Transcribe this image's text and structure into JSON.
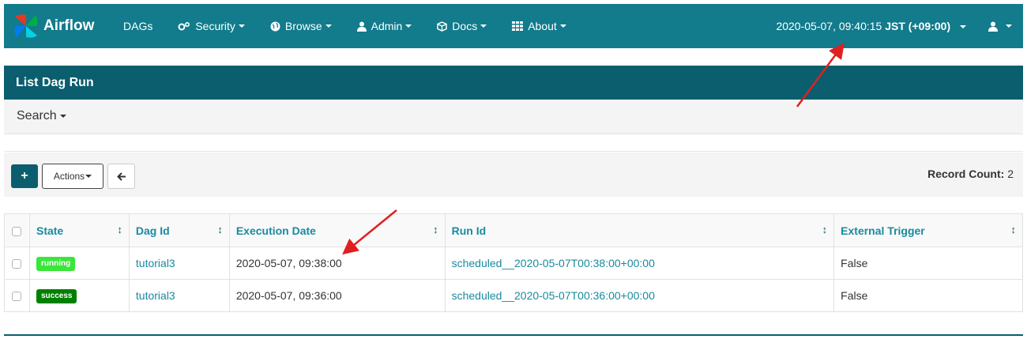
{
  "navbar": {
    "brand": "Airflow",
    "items": [
      {
        "label": "DAGs",
        "icon": "none",
        "dropdown": false
      },
      {
        "label": "Security",
        "icon": "cogs-icon",
        "dropdown": true
      },
      {
        "label": "Browse",
        "icon": "globe-icon",
        "dropdown": true
      },
      {
        "label": "Admin",
        "icon": "user-icon",
        "dropdown": true
      },
      {
        "label": "Docs",
        "icon": "cube-icon",
        "dropdown": true
      },
      {
        "label": "About",
        "icon": "grid-icon",
        "dropdown": true
      }
    ],
    "clock_time": "2020-05-07, 09:40:15",
    "clock_tz": "JST (+09:00)"
  },
  "panel": {
    "title": "List Dag Run",
    "search_label": "Search"
  },
  "toolbar": {
    "add_label": "+",
    "actions_label": "Actions",
    "record_count_label": "Record Count:",
    "record_count": "2"
  },
  "table": {
    "headers": [
      "State",
      "Dag Id",
      "Execution Date",
      "Run Id",
      "External Trigger"
    ],
    "rows": [
      {
        "state": "running",
        "dag_id": "tutorial3",
        "execution_date": "2020-05-07, 09:38:00",
        "run_id": "scheduled__2020-05-07T00:38:00+00:00",
        "external_trigger": "False"
      },
      {
        "state": "success",
        "dag_id": "tutorial3",
        "execution_date": "2020-05-07, 09:36:00",
        "run_id": "scheduled__2020-05-07T00:36:00+00:00",
        "external_trigger": "False"
      }
    ]
  },
  "colors": {
    "navbar": "#127b8c",
    "panel_heading": "#0b5e6e",
    "link": "#1a8aa0",
    "running": "#3ae63a",
    "success": "#008000",
    "annotation_arrow": "#e02020"
  }
}
